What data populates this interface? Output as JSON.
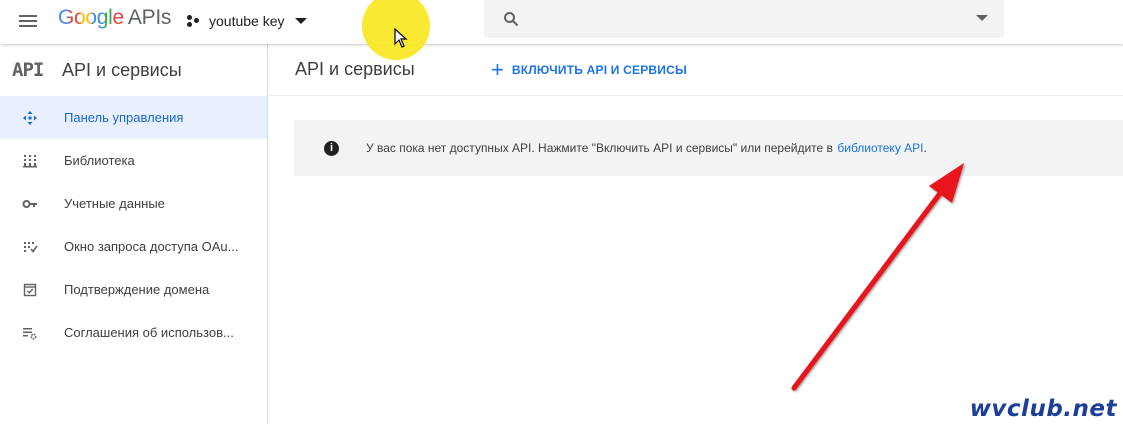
{
  "header": {
    "logo_google": "Google",
    "logo_apis": "APIs",
    "project_name": "youtube key",
    "search_placeholder": ""
  },
  "sidebar": {
    "api_mark": "API",
    "title": "API и сервисы",
    "items": [
      {
        "label": "Панель управления",
        "icon": "dashboard-icon",
        "active": true
      },
      {
        "label": "Библиотека",
        "icon": "library-icon",
        "active": false
      },
      {
        "label": "Учетные данные",
        "icon": "key-icon",
        "active": false
      },
      {
        "label": "Окно запроса доступа OAu...",
        "icon": "oauth-consent-icon",
        "active": false
      },
      {
        "label": "Подтверждение домена",
        "icon": "domain-verification-icon",
        "active": false
      },
      {
        "label": "Соглашения об использов...",
        "icon": "settings-list-icon",
        "active": false
      }
    ]
  },
  "main": {
    "title": "API и сервисы",
    "enable_button": "ВКЛЮЧИТЬ API И СЕРВИСЫ",
    "notice": {
      "text": "У вас пока нет доступных API. Нажмите \"Включить API и сервисы\" или перейдите в ",
      "link": "библиотеку API",
      "suffix": "."
    }
  },
  "watermark": "wvclub.net",
  "colors": {
    "accent": "#1a73e8",
    "active_bg": "#e8f0fe",
    "highlight": "#f8e71c",
    "arrow": "#e8141b"
  }
}
